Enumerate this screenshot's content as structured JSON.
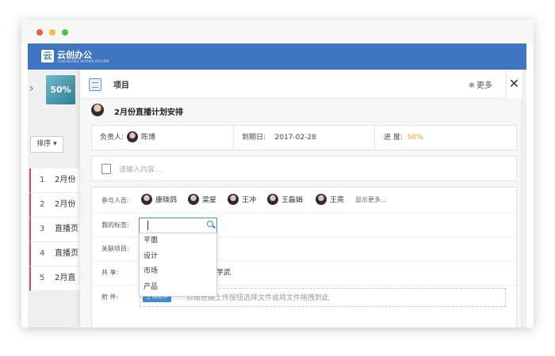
{
  "app": {
    "logo_mark": "云",
    "name": "云创办公",
    "subtitle": "YUNCHUANG WORKPLATFORM"
  },
  "left_panel": {
    "thumbnail_label": "50%",
    "sort_label": "排序 ▾",
    "items": [
      {
        "num": "1",
        "text": "2月份"
      },
      {
        "num": "2",
        "text": "2月份"
      },
      {
        "num": "3",
        "text": "直播页"
      },
      {
        "num": "4",
        "text": "直播页"
      },
      {
        "num": "5",
        "text": "2月直"
      }
    ]
  },
  "panel": {
    "title": "项目",
    "more_label": "更多",
    "close_label": "✕",
    "task_title": "2月份直播计划安排",
    "info": {
      "owner_label": "负责人:",
      "owner_name": "陈博",
      "due_label": "到期日:",
      "due_value": "2017-02-28",
      "progress_label": "进  度:",
      "progress_value": "50%"
    },
    "comment_placeholder": "请输入内容...",
    "fields": {
      "participants_label": "参与人员:",
      "participants": [
        "康晓鸽",
        "梁星",
        "王冲",
        "王磊娟",
        "王亮"
      ],
      "show_more": "显示更多...",
      "tags_label": "我的标签:",
      "related_label": "关联项目:",
      "share_label": "共    享:",
      "share_value": "学武",
      "attach_label": "附    件:",
      "upload_button": "上传附件",
      "upload_tip": "点击左侧上传按钮选择文件或将文件拖拽到此"
    },
    "tag_options": [
      "平面",
      "设计",
      "市场",
      "产品"
    ]
  },
  "colors": {
    "brand": "#3f75c1",
    "accent": "#f39b1d",
    "list_marker": "#d64a6e"
  }
}
